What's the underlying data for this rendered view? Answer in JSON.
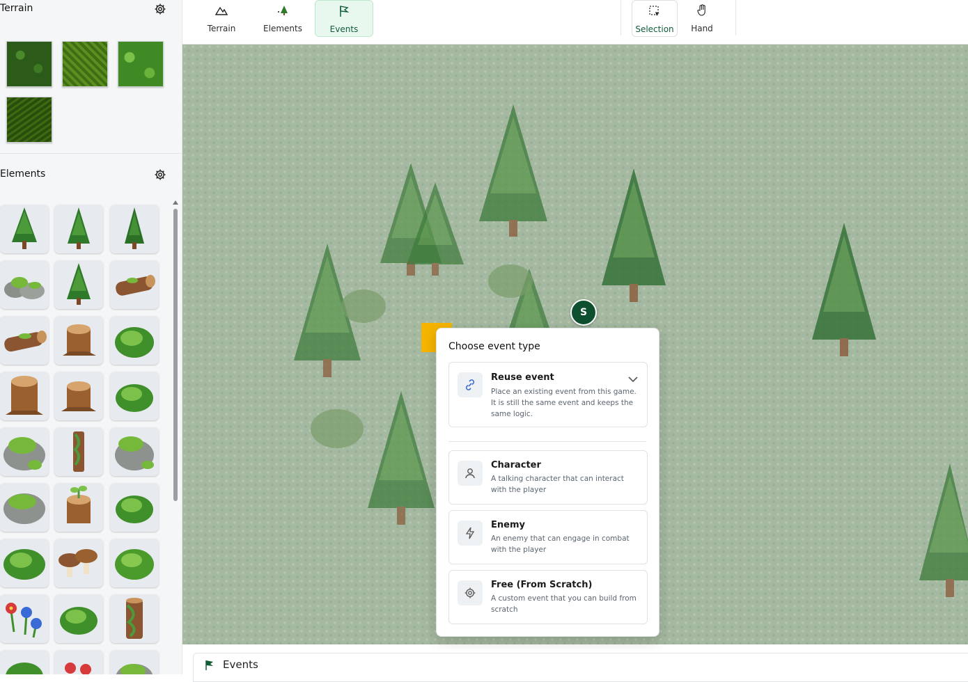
{
  "sidebar": {
    "terrain_title": "Terrain",
    "elements_title": "Elements"
  },
  "toolbar": {
    "terrain_label": "Terrain",
    "elements_label": "Elements",
    "events_label": "Events",
    "selection_label": "Selection",
    "hand_label": "Hand",
    "active_tool": "Events",
    "active_color": "#0f5c36"
  },
  "canvas": {
    "avatar_letter": "S",
    "marker_color": "#f5b400"
  },
  "popup": {
    "title": "Choose event type",
    "options": [
      {
        "title": "Reuse event",
        "desc": "Place an existing event from this game. It is still the same event and keeps the same logic.",
        "icon": "link-icon"
      },
      {
        "title": "Character",
        "desc": "A talking character that can interact with the player",
        "icon": "person-icon"
      },
      {
        "title": "Enemy",
        "desc": "An enemy that can engage in combat with the player",
        "icon": "lightning-icon"
      },
      {
        "title": "Free (From Scratch)",
        "desc": "A custom event that you can build from scratch",
        "icon": "gear-icon"
      }
    ]
  },
  "bottom_panel": {
    "label": "Events"
  }
}
